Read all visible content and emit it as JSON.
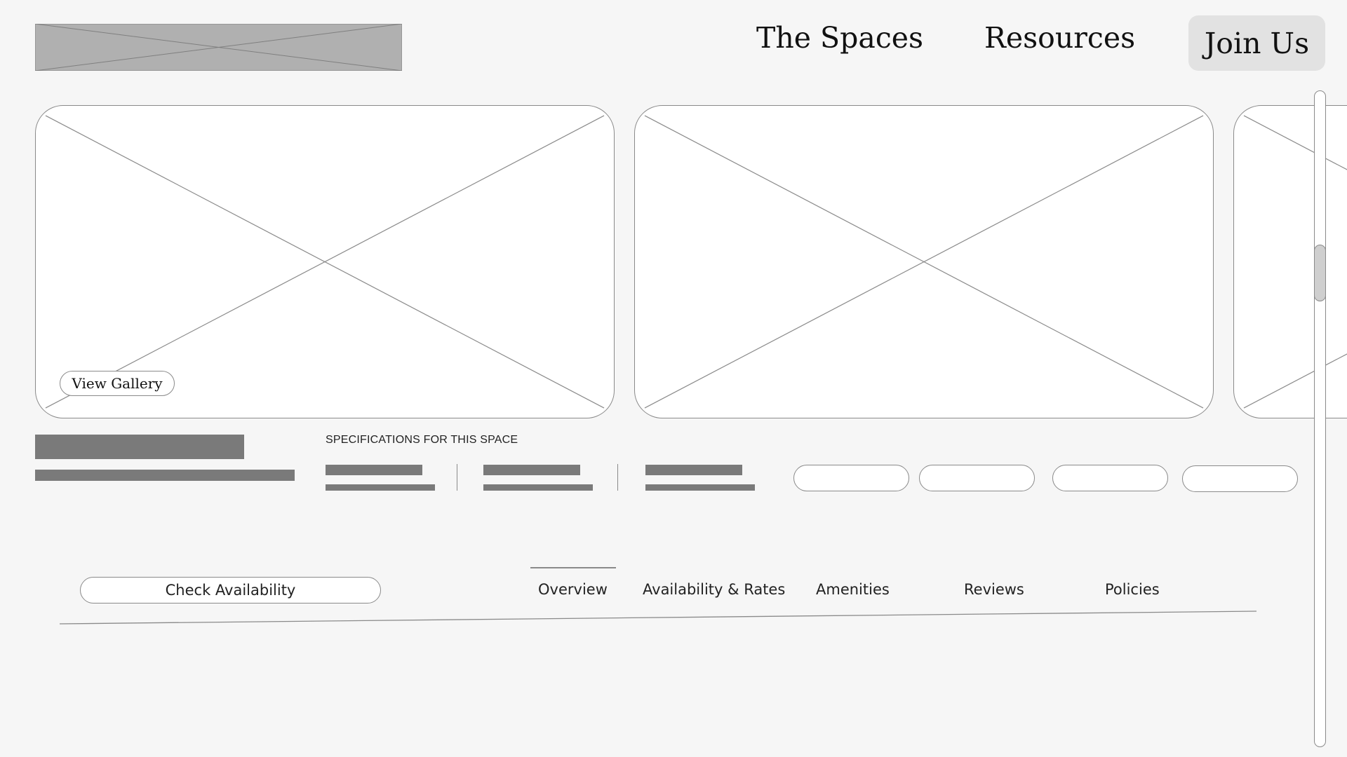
{
  "header": {
    "nav": {
      "spaces_label": "The Spaces",
      "resources_label": "Resources"
    },
    "join_label": "Join Us"
  },
  "gallery": {
    "view_gallery_label": "View Gallery",
    "scroll_position": 0.24
  },
  "details": {
    "spec_heading": "SPECIFICATIONS FOR THIS SPACE"
  },
  "bottom_nav": {
    "check_availability_label": "Check Availability",
    "tabs": [
      {
        "label": "Overview"
      },
      {
        "label": "Availability & Rates"
      },
      {
        "label": "Amenities"
      },
      {
        "label": "Reviews"
      },
      {
        "label": "Policies"
      }
    ],
    "active_tab": "Overview"
  },
  "colors": {
    "background": "#f6f6f6",
    "placeholder_fill": "#7a7a7a",
    "logo_fill": "#b0b0b0",
    "join_button_bg": "#e2e2e2",
    "stroke": "#8a8a8a"
  },
  "icons": {
    "image_placeholder": "image-placeholder-icon"
  }
}
